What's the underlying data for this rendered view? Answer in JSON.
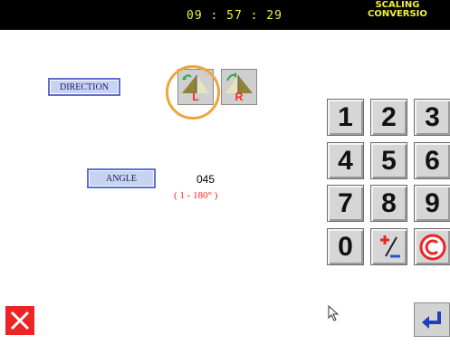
{
  "header": {
    "time": "09 : 57 : 29",
    "mode_line1": "SCALING",
    "mode_line2": "CONVERSIO"
  },
  "direction": {
    "label": "DIRECTION",
    "options": [
      {
        "letter": "L",
        "selected": true
      },
      {
        "letter": "R",
        "selected": false
      }
    ]
  },
  "angle": {
    "label": "ANGLE",
    "value": "045",
    "range": "( 1 - 180° )"
  },
  "keypad": {
    "keys": [
      "1",
      "2",
      "3",
      "4",
      "5",
      "6",
      "7",
      "8",
      "9",
      "0"
    ],
    "sign_key_icon": "plus-minus-icon",
    "clear_key_icon": "clear-circle-c-icon"
  },
  "footer": {
    "close_icon": "close-icon",
    "enter_icon": "enter-arrow-icon"
  },
  "colors": {
    "header_bg": "#000000",
    "header_text": "#f2ef3a",
    "accent_red": "#ee2424",
    "enter_blue": "#1f3fbf",
    "highlight_orange": "#f0a53a"
  }
}
